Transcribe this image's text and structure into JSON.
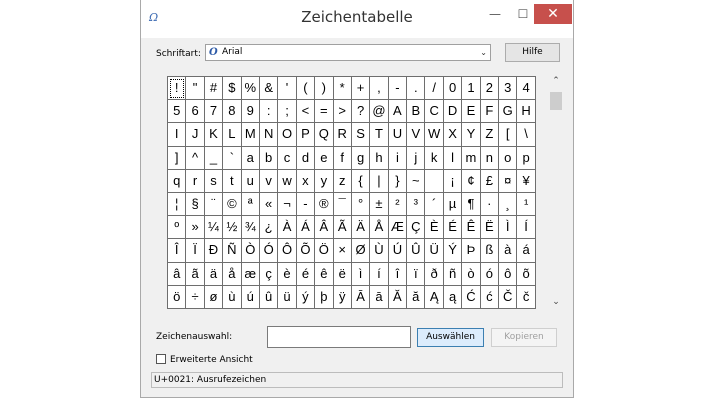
{
  "window": {
    "title": "Zeichentabelle"
  },
  "toolbar": {
    "font_label": "Schriftart:",
    "font_value": "Arial",
    "help_label": "Hilfe"
  },
  "chars": [
    "!",
    "\"",
    "#",
    "$",
    "%",
    "&",
    "'",
    "(",
    ")",
    "*",
    "+",
    ",",
    "-",
    ".",
    "/",
    "0",
    "1",
    "2",
    "3",
    "4",
    "5",
    "6",
    "7",
    "8",
    "9",
    ":",
    ";",
    "<",
    "=",
    ">",
    "?",
    "@",
    "A",
    "B",
    "C",
    "D",
    "E",
    "F",
    "G",
    "H",
    "I",
    "J",
    "K",
    "L",
    "M",
    "N",
    "O",
    "P",
    "Q",
    "R",
    "S",
    "T",
    "U",
    "V",
    "W",
    "X",
    "Y",
    "Z",
    "[",
    "\\",
    "]",
    "^",
    "_",
    "`",
    "a",
    "b",
    "c",
    "d",
    "e",
    "f",
    "g",
    "h",
    "i",
    "j",
    "k",
    "l",
    "m",
    "n",
    "o",
    "p",
    "q",
    "r",
    "s",
    "t",
    "u",
    "v",
    "w",
    "x",
    "y",
    "z",
    "{",
    "|",
    "}",
    "~",
    " ",
    "¡",
    "¢",
    "£",
    "¤",
    "¥",
    "¦",
    "§",
    "¨",
    "©",
    "ª",
    "«",
    "¬",
    "-",
    "®",
    "¯",
    "°",
    "±",
    "²",
    "³",
    "´",
    "µ",
    "¶",
    "·",
    "¸",
    "¹",
    "º",
    "»",
    "¼",
    "½",
    "¾",
    "¿",
    "À",
    "Á",
    "Â",
    "Ã",
    "Ä",
    "Å",
    "Æ",
    "Ç",
    "È",
    "É",
    "Ê",
    "Ë",
    "Ì",
    "Í",
    "Î",
    "Ï",
    "Ð",
    "Ñ",
    "Ò",
    "Ó",
    "Ô",
    "Õ",
    "Ö",
    "×",
    "Ø",
    "Ù",
    "Ú",
    "Û",
    "Ü",
    "Ý",
    "Þ",
    "ß",
    "à",
    "á",
    "â",
    "ã",
    "ä",
    "å",
    "æ",
    "ç",
    "è",
    "é",
    "ê",
    "ë",
    "ì",
    "í",
    "î",
    "ï",
    "ð",
    "ñ",
    "ò",
    "ó",
    "ô",
    "õ",
    "ö",
    "÷",
    "ø",
    "ù",
    "ú",
    "û",
    "ü",
    "ý",
    "þ",
    "ÿ",
    "Ā",
    "ā",
    "Ă",
    "ă",
    "Ą",
    "ą",
    "Ć",
    "ć",
    "Č",
    "č"
  ],
  "selection": {
    "label": "Zeichenauswahl:",
    "value": "",
    "select_label": "Auswählen",
    "copy_label": "Kopieren"
  },
  "advanced": {
    "label": "Erweiterte Ansicht"
  },
  "status": {
    "text": "U+0021: Ausrufezeichen"
  },
  "icons": {
    "app": "charmap-icon",
    "dropdown": "chevron-down-icon",
    "scroll_up": "chevron-up-icon",
    "scroll_down": "chevron-down-icon"
  },
  "colors": {
    "close_button": "#c7504c",
    "font_icon": "#2d5aa7",
    "focus_button": "#dcecfc"
  }
}
